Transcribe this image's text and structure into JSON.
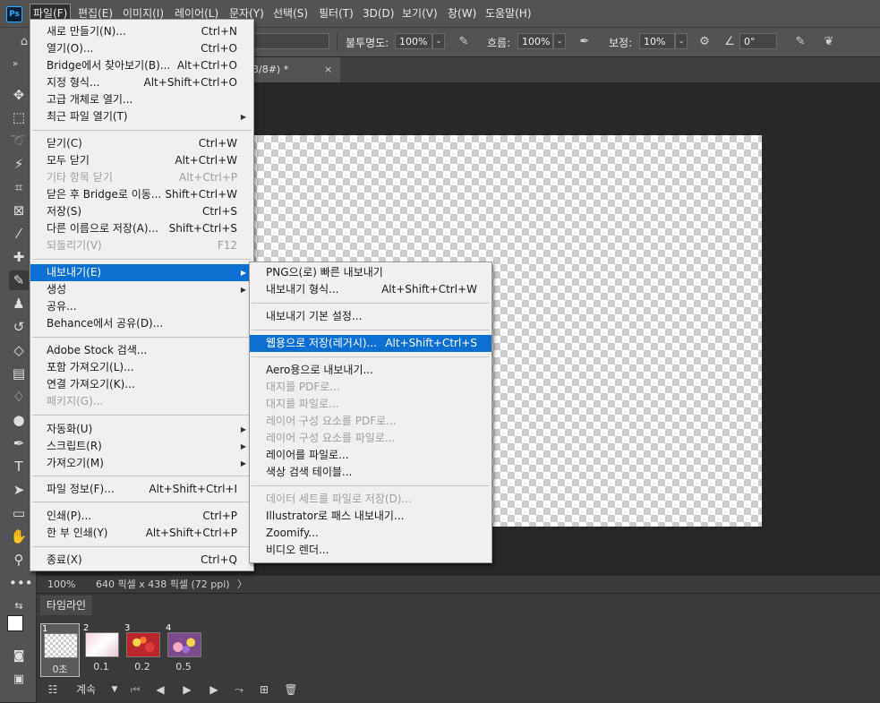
{
  "app": {
    "logo": "Ps"
  },
  "menubar": {
    "items": [
      "파일(F)",
      "편집(E)",
      "이미지(I)",
      "레이어(L)",
      "문자(Y)",
      "선택(S)",
      "필터(T)",
      "3D(D)",
      "보기(V)",
      "창(W)",
      "도움말(H)"
    ]
  },
  "options": {
    "opacity_label": "불투명도:",
    "opacity_value": "100%",
    "flow_label": "흐름:",
    "flow_value": "100%",
    "smoothing_label": "보정:",
    "smoothing_value": "10%",
    "angle_value": "0°"
  },
  "document_tab": {
    "title": "3/8#) *",
    "close": "×"
  },
  "file_menu": {
    "items": [
      {
        "label": "새로 만들기(N)...",
        "shortcut": "Ctrl+N"
      },
      {
        "label": "열기(O)...",
        "shortcut": "Ctrl+O"
      },
      {
        "label": "Bridge에서 찾아보기(B)...",
        "shortcut": "Alt+Ctrl+O"
      },
      {
        "label": "지정 형식...",
        "shortcut": "Alt+Shift+Ctrl+O"
      },
      {
        "label": "고급 개체로 열기...",
        "shortcut": ""
      },
      {
        "label": "최근 파일 열기(T)",
        "shortcut": ""
      },
      {
        "label": "닫기(C)",
        "shortcut": "Ctrl+W"
      },
      {
        "label": "모두 닫기",
        "shortcut": "Alt+Ctrl+W"
      },
      {
        "label": "기타 항목 닫기",
        "shortcut": "Alt+Ctrl+P"
      },
      {
        "label": "닫은 후 Bridge로 이동...",
        "shortcut": "Shift+Ctrl+W"
      },
      {
        "label": "저장(S)",
        "shortcut": "Ctrl+S"
      },
      {
        "label": "다른 이름으로 저장(A)...",
        "shortcut": "Shift+Ctrl+S"
      },
      {
        "label": "되돌리기(V)",
        "shortcut": "F12"
      },
      {
        "label": "내보내기(E)",
        "shortcut": ""
      },
      {
        "label": "생성",
        "shortcut": ""
      },
      {
        "label": "공유...",
        "shortcut": ""
      },
      {
        "label": "Behance에서 공유(D)...",
        "shortcut": ""
      },
      {
        "label": "Adobe Stock 검색...",
        "shortcut": ""
      },
      {
        "label": "포함 가져오기(L)...",
        "shortcut": ""
      },
      {
        "label": "연결 가져오기(K)...",
        "shortcut": ""
      },
      {
        "label": "패키지(G)...",
        "shortcut": ""
      },
      {
        "label": "자동화(U)",
        "shortcut": ""
      },
      {
        "label": "스크립트(R)",
        "shortcut": ""
      },
      {
        "label": "가져오기(M)",
        "shortcut": ""
      },
      {
        "label": "파일 정보(F)...",
        "shortcut": "Alt+Shift+Ctrl+I"
      },
      {
        "label": "인쇄(P)...",
        "shortcut": "Ctrl+P"
      },
      {
        "label": "한 부 인쇄(Y)",
        "shortcut": "Alt+Shift+Ctrl+P"
      },
      {
        "label": "종료(X)",
        "shortcut": "Ctrl+Q"
      }
    ]
  },
  "export_menu": {
    "items": [
      {
        "label": "PNG으(로) 빠른 내보내기",
        "shortcut": ""
      },
      {
        "label": "내보내기 형식...",
        "shortcut": "Alt+Shift+Ctrl+W"
      },
      {
        "label": "내보내기 기본 설정...",
        "shortcut": ""
      },
      {
        "label": "웹용으로 저장(레거시)...",
        "shortcut": "Alt+Shift+Ctrl+S"
      },
      {
        "label": "Aero용으로 내보내기...",
        "shortcut": ""
      },
      {
        "label": "대지를 PDF로...",
        "shortcut": ""
      },
      {
        "label": "대지를 파일로...",
        "shortcut": ""
      },
      {
        "label": "레이어 구성 요소를 PDF로...",
        "shortcut": ""
      },
      {
        "label": "레이어 구성 요소를 파일로...",
        "shortcut": ""
      },
      {
        "label": "레이어를 파일로...",
        "shortcut": ""
      },
      {
        "label": "색상 검색 테이블...",
        "shortcut": ""
      },
      {
        "label": "데이터 세트를 파일로 저장(D)...",
        "shortcut": ""
      },
      {
        "label": "Illustrator로 패스 내보내기...",
        "shortcut": ""
      },
      {
        "label": "Zoomify...",
        "shortcut": ""
      },
      {
        "label": "비디오 렌더...",
        "shortcut": ""
      }
    ]
  },
  "status": {
    "zoom": "100%",
    "doc_size": "640 픽셀 x 438 픽셀 (72 ppi)",
    "arrow": "〉"
  },
  "timeline": {
    "tab_label": "타임라인",
    "frames": [
      {
        "num": "1",
        "time": "0초"
      },
      {
        "num": "2",
        "time": "0.1"
      },
      {
        "num": "3",
        "time": "0.2"
      },
      {
        "num": "4",
        "time": "0.5"
      }
    ],
    "loop_label": "계속"
  },
  "colors": {
    "accent": "#0d6fd1",
    "menu_bg": "#f0f0f0",
    "ui_bg": "#535353",
    "canvas_bg": "#282828"
  }
}
